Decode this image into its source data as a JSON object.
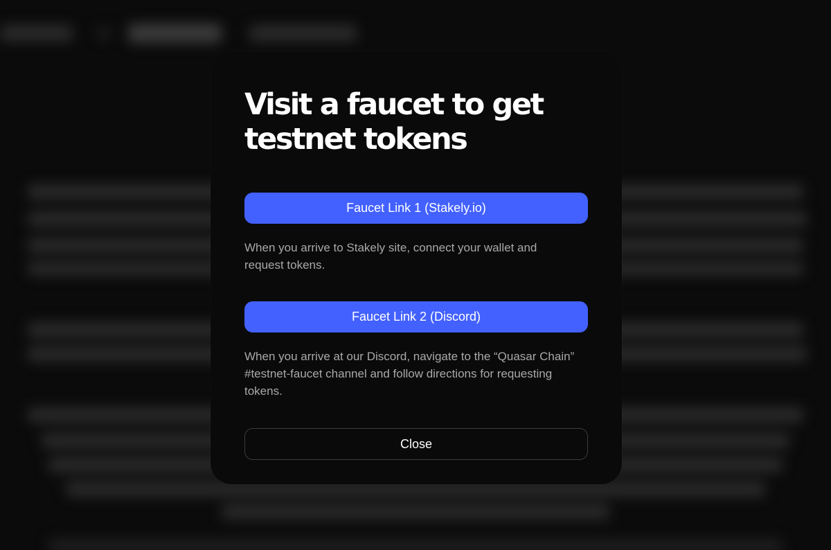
{
  "modal": {
    "title": "Visit a faucet to get testnet tokens",
    "faucet_link_1": {
      "label": "Faucet Link 1 (Stakely.io)",
      "description": "When you arrive to Stakely site, connect your wallet and request tokens."
    },
    "faucet_link_2": {
      "label": "Faucet Link 2 (Discord)",
      "description": "When you arrive at our Discord, navigate to the “Quasar Chain” #testnet-faucet channel and follow directions for requesting tokens."
    },
    "close_label": "Close"
  },
  "colors": {
    "accent": "#4361ff",
    "modal_background": "#0a0a0a",
    "description_text": "#a9a9a9"
  }
}
